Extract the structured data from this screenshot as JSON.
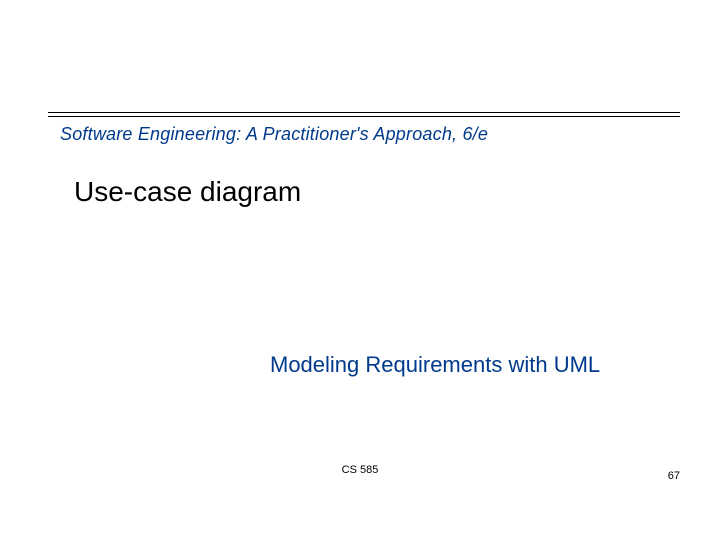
{
  "header": {
    "book_title": "Software Engineering: A Practitioner's Approach, 6/e"
  },
  "content": {
    "slide_title": "Use-case diagram",
    "subtitle": "Modeling Requirements with UML"
  },
  "footer": {
    "course": "CS 585",
    "page_number": "67"
  }
}
